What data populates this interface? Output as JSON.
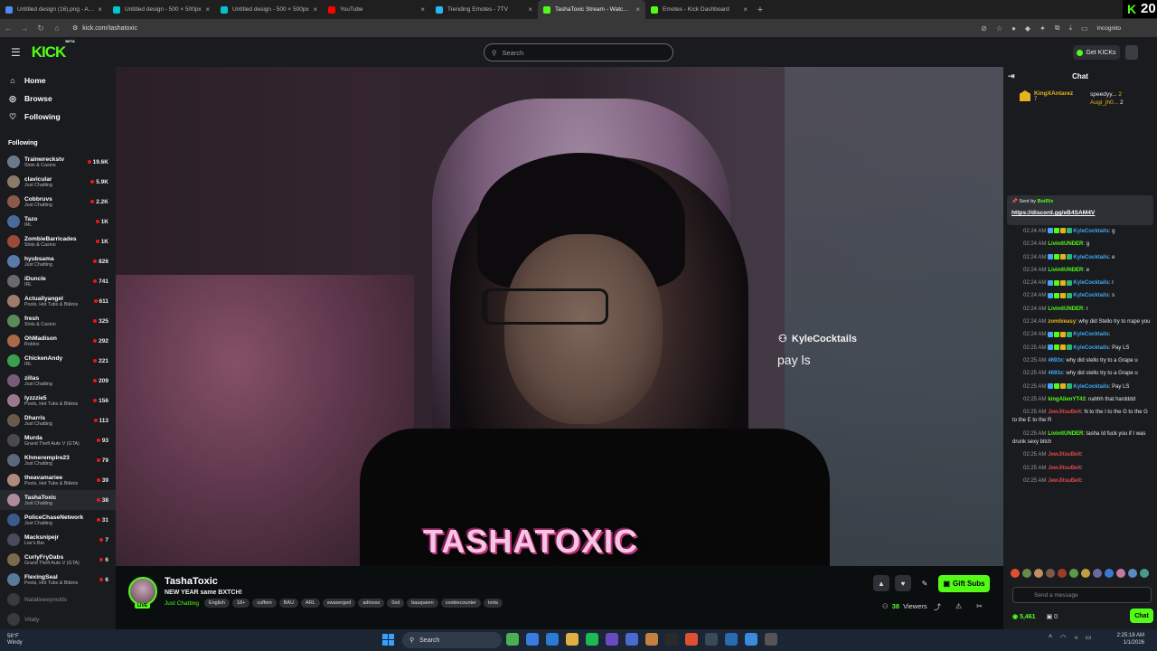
{
  "browser": {
    "tabs": [
      {
        "label": "Untitled design (16).png - Anim",
        "color": "#4c8bf5"
      },
      {
        "label": "Untitled design - 500 × 500px",
        "color": "#00c4cc"
      },
      {
        "label": "Untitled design - 500 × 500px",
        "color": "#00c4cc"
      },
      {
        "label": "YouTube",
        "color": "#ff0000"
      },
      {
        "label": "Trending Emotes - 7TV",
        "color": "#29b6f6"
      },
      {
        "label": "TashaToxic Stream - Watch Live",
        "color": "#53fc18"
      },
      {
        "label": "Emotes - Kick Dashboard",
        "color": "#53fc18"
      }
    ],
    "url": "kick.com/tashatoxic",
    "incognito": "Incognito",
    "overlay_k": "K",
    "overlay_num1": "20",
    "overlay_num2": "0"
  },
  "header": {
    "logo": "KICK",
    "logo_beta": "BETA",
    "search_placeholder": "Search",
    "get_kicks": "Get KICKs"
  },
  "sidebar": {
    "nav": [
      {
        "label": "Home",
        "icon": "home-icon"
      },
      {
        "label": "Browse",
        "icon": "compass-icon"
      },
      {
        "label": "Following",
        "icon": "heart-icon"
      }
    ],
    "following_title": "Following",
    "following": [
      {
        "name": "Trainwreckstv",
        "cat": "Slots & Casino",
        "viewers": "19.6K",
        "c": "#6a7a8a"
      },
      {
        "name": "clavicular",
        "cat": "Just Chatting",
        "viewers": "5.9K",
        "c": "#8a7a6a"
      },
      {
        "name": "Cobbruvs",
        "cat": "Just Chatting",
        "viewers": "2.2K",
        "c": "#8a5a4a"
      },
      {
        "name": "Tazo",
        "cat": "IRL",
        "viewers": "1K",
        "c": "#4a6a9a"
      },
      {
        "name": "ZombieBarricades",
        "cat": "Slots & Casino",
        "viewers": "1K",
        "c": "#9a4a3a"
      },
      {
        "name": "hyubsama",
        "cat": "Just Chatting",
        "viewers": "826",
        "c": "#5a7aaa"
      },
      {
        "name": "iDuncle",
        "cat": "IRL",
        "viewers": "741",
        "c": "#6a6a6a"
      },
      {
        "name": "Actuallyangel",
        "cat": "Pools, Hot Tubs & Bikinis",
        "viewers": "611",
        "c": "#a07a6a"
      },
      {
        "name": "fresh",
        "cat": "Slots & Casino",
        "viewers": "325",
        "c": "#5a8a5a"
      },
      {
        "name": "OhMadison",
        "cat": "Roblox",
        "viewers": "292",
        "c": "#aa6a4a"
      },
      {
        "name": "ChickenAndy",
        "cat": "IRL",
        "viewers": "221",
        "c": "#3aa050"
      },
      {
        "name": "zillas",
        "cat": "Just Chatting",
        "viewers": "209",
        "c": "#7a5a7a"
      },
      {
        "name": "lyzzzie5",
        "cat": "Pools, Hot Tubs & Bikinis",
        "viewers": "156",
        "c": "#9a7a8a"
      },
      {
        "name": "Dharris",
        "cat": "Just Chatting",
        "viewers": "113",
        "c": "#6a5a4a"
      },
      {
        "name": "Murda",
        "cat": "Grand Theft Auto V (GTA)",
        "viewers": "93",
        "c": "#4a4a4a"
      },
      {
        "name": "Khmerempire23",
        "cat": "Just Chatting",
        "viewers": "79",
        "c": "#5a6a7a"
      },
      {
        "name": "theavamariee",
        "cat": "Pools, Hot Tubs & Bikinis",
        "viewers": "39",
        "c": "#b08a7a"
      },
      {
        "name": "TashaToxic",
        "cat": "Just Chatting",
        "viewers": "38",
        "c": "#b08aa0",
        "selected": true
      },
      {
        "name": "PoliceChaseNetwork",
        "cat": "Just Chatting",
        "viewers": "31",
        "c": "#3a5a8a"
      },
      {
        "name": "Macksnipejr",
        "cat": "Liar's Bar",
        "viewers": "7",
        "c": "#4a4a5a"
      },
      {
        "name": "CurlyFryDabs",
        "cat": "Grand Theft Auto V (GTA)",
        "viewers": "6",
        "c": "#7a6a4a"
      },
      {
        "name": "FlexingSeal",
        "cat": "Pools, Hot Tubs & Bikinis",
        "viewers": "6",
        "c": "#5a7a9a"
      },
      {
        "name": "Natalieeeynolds",
        "cat": "",
        "viewers": "",
        "c": "#6a6a6a",
        "offline": true
      },
      {
        "name": "Vitaty",
        "cat": "",
        "viewers": "",
        "c": "#6a6a6a",
        "offline": true
      }
    ]
  },
  "video": {
    "overlay_user": "KyleCocktails",
    "overlay_msg": "pay ls",
    "stream_logo": "TASHATOXIC"
  },
  "stream": {
    "name": "TashaToxic",
    "title": "NEW YEAR same BXTCH!",
    "live": "LIVE",
    "category": "Just Chatting",
    "tags": [
      "English",
      "18+",
      "cuffem",
      "BAU",
      "ARL",
      "swaxerged",
      "adinoss",
      "0xd",
      "bauqueen",
      "cookiecounter",
      "torta"
    ],
    "gift_subs": "Gift Subs",
    "viewers_count": "38",
    "viewers_label": "Viewers"
  },
  "chat": {
    "title": "Chat",
    "leader": {
      "name": "KingXAntarez",
      "count": "7",
      "r1": "speedyy...",
      "r1c": "2",
      "r2": "Augi_jh0...",
      "r2c": "2"
    },
    "pinned": {
      "sent_by": "Sent by",
      "user": "BotRix",
      "link": "https://discord.gg/eB4SAM4V"
    },
    "messages": [
      {
        "time": "02:24 AM",
        "user": "KyleCocktails",
        "color": "#3fa9f5",
        "text": "g",
        "badges": true
      },
      {
        "time": "02:24 AM",
        "user": "LivinitUNDER",
        "color": "#53fc18",
        "text": "g"
      },
      {
        "time": "02:24 AM",
        "user": "KyleCocktails",
        "color": "#3fa9f5",
        "text": "e",
        "badges": true
      },
      {
        "time": "02:24 AM",
        "user": "LivinitUNDER",
        "color": "#53fc18",
        "text": "e"
      },
      {
        "time": "02:24 AM",
        "user": "KyleCocktails",
        "color": "#3fa9f5",
        "text": "r",
        "badges": true
      },
      {
        "time": "02:24 AM",
        "user": "KyleCocktails",
        "color": "#3fa9f5",
        "text": "s",
        "badges": true
      },
      {
        "time": "02:24 AM",
        "user": "LivinitUNDER",
        "color": "#53fc18",
        "text": "r"
      },
      {
        "time": "02:24 AM",
        "user": "zombieasy",
        "color": "#e7b21c",
        "text": "why did Stello try to rrape you"
      },
      {
        "time": "02:24 AM",
        "user": "KyleCocktails",
        "color": "#3fa9f5",
        "text": "",
        "badges": true
      },
      {
        "time": "02:25 AM",
        "user": "KyleCocktails",
        "color": "#3fa9f5",
        "text": "Pay LS",
        "badges": true
      },
      {
        "time": "02:25 AM",
        "user": "4693x",
        "color": "#3fa9f5",
        "text": "why did stello try to a Grape u"
      },
      {
        "time": "02:25 AM",
        "user": "4693x",
        "color": "#3fa9f5",
        "text": "why did stello try to a Grape u"
      },
      {
        "time": "02:25 AM",
        "user": "KyleCocktails",
        "color": "#3fa9f5",
        "text": "Pay LS",
        "badges": true
      },
      {
        "time": "02:25 AM",
        "user": "kingAlienYT43",
        "color": "#53fc18",
        "text": "nahhh that hardddd"
      },
      {
        "time": "02:25 AM",
        "user": "JewJitsuBelt",
        "color": "#e04a4a",
        "text": "N to the I to the G to the G to the E to the R"
      },
      {
        "time": "02:25 AM",
        "user": "LivinitUNDER",
        "color": "#53fc18",
        "text": "tasha Id fuck you if I was drunk sexy bitch"
      },
      {
        "time": "02:25 AM",
        "user": "JewJitsuBelt",
        "color": "#e04a4a",
        "text": ""
      },
      {
        "time": "02:25 AM",
        "user": "JewJitsuBelt",
        "color": "#e04a4a",
        "text": ""
      },
      {
        "time": "02:25 AM",
        "user": "JewJitsuBelt",
        "color": "#e04a4a",
        "text": ""
      }
    ],
    "input_placeholder": "Send a message",
    "kicks_balance": "5,461",
    "gifts": "0",
    "chat_button": "Chat"
  },
  "taskbar": {
    "weather_temp": "58°F",
    "weather_desc": "Windy",
    "search": "Search",
    "time": "2:25:18 AM",
    "date": "1/1/2026"
  }
}
